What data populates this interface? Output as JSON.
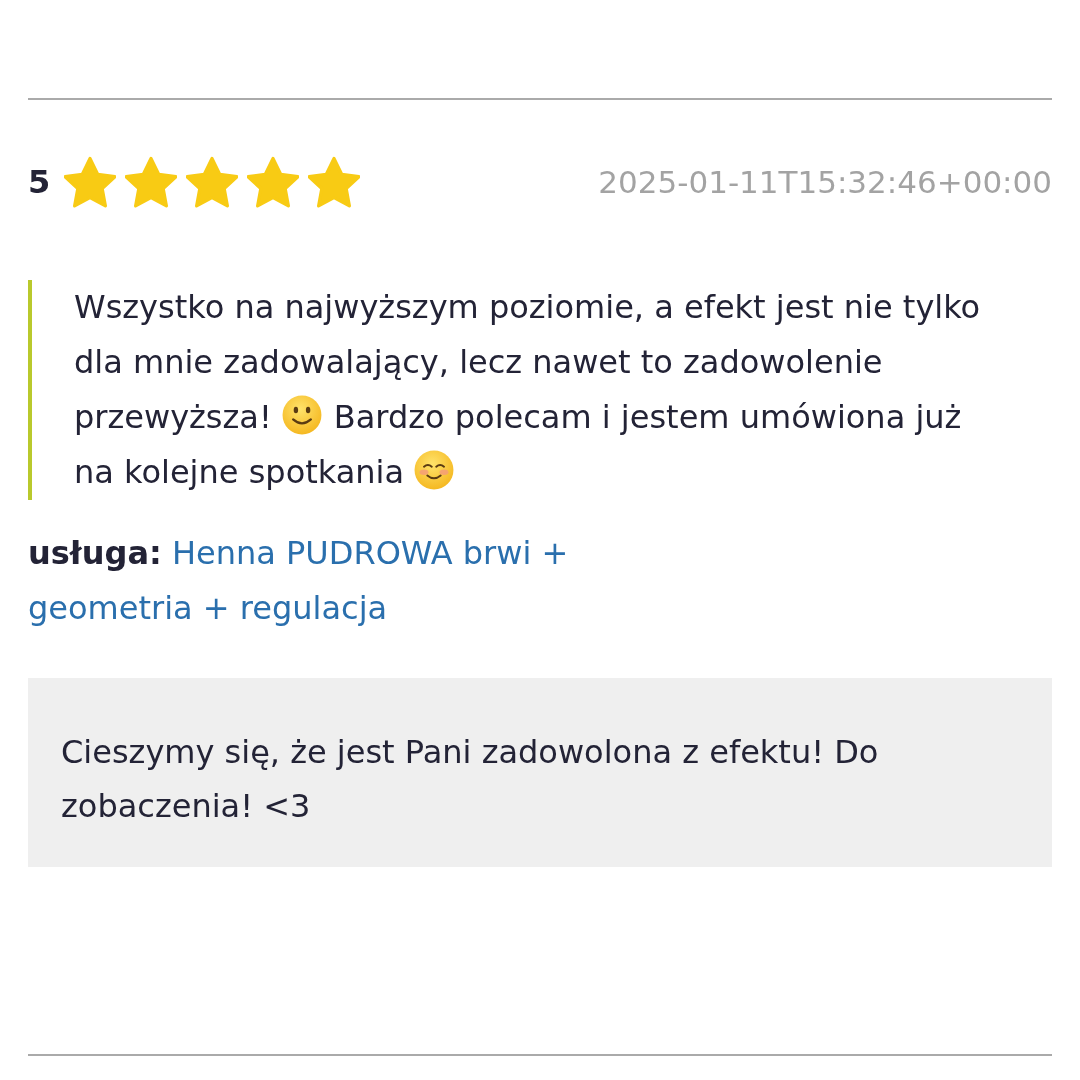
{
  "rating": {
    "score": "5",
    "stars": 5
  },
  "date": "2025-01-11T15:32:46+00:00",
  "review": {
    "parts": [
      {
        "kind": "text",
        "text": "Wszystko na najwyższym poziomie, a efekt jest nie tylko dla mnie zadowalający, lecz nawet to zadowolenie przewyższa!"
      },
      {
        "kind": "smile"
      },
      {
        "kind": "text",
        "text": "Bardzo polecam i jestem umówiona już na kolejne spotkania"
      },
      {
        "kind": "blush"
      }
    ]
  },
  "service": {
    "label": "usługa:",
    "value": "Henna PUDROWA brwi + geometria + regulacja"
  },
  "reply": {
    "text": "Cieszymy się, że jest Pani zadowolona z efektu! Do zobaczenia! <3"
  }
}
